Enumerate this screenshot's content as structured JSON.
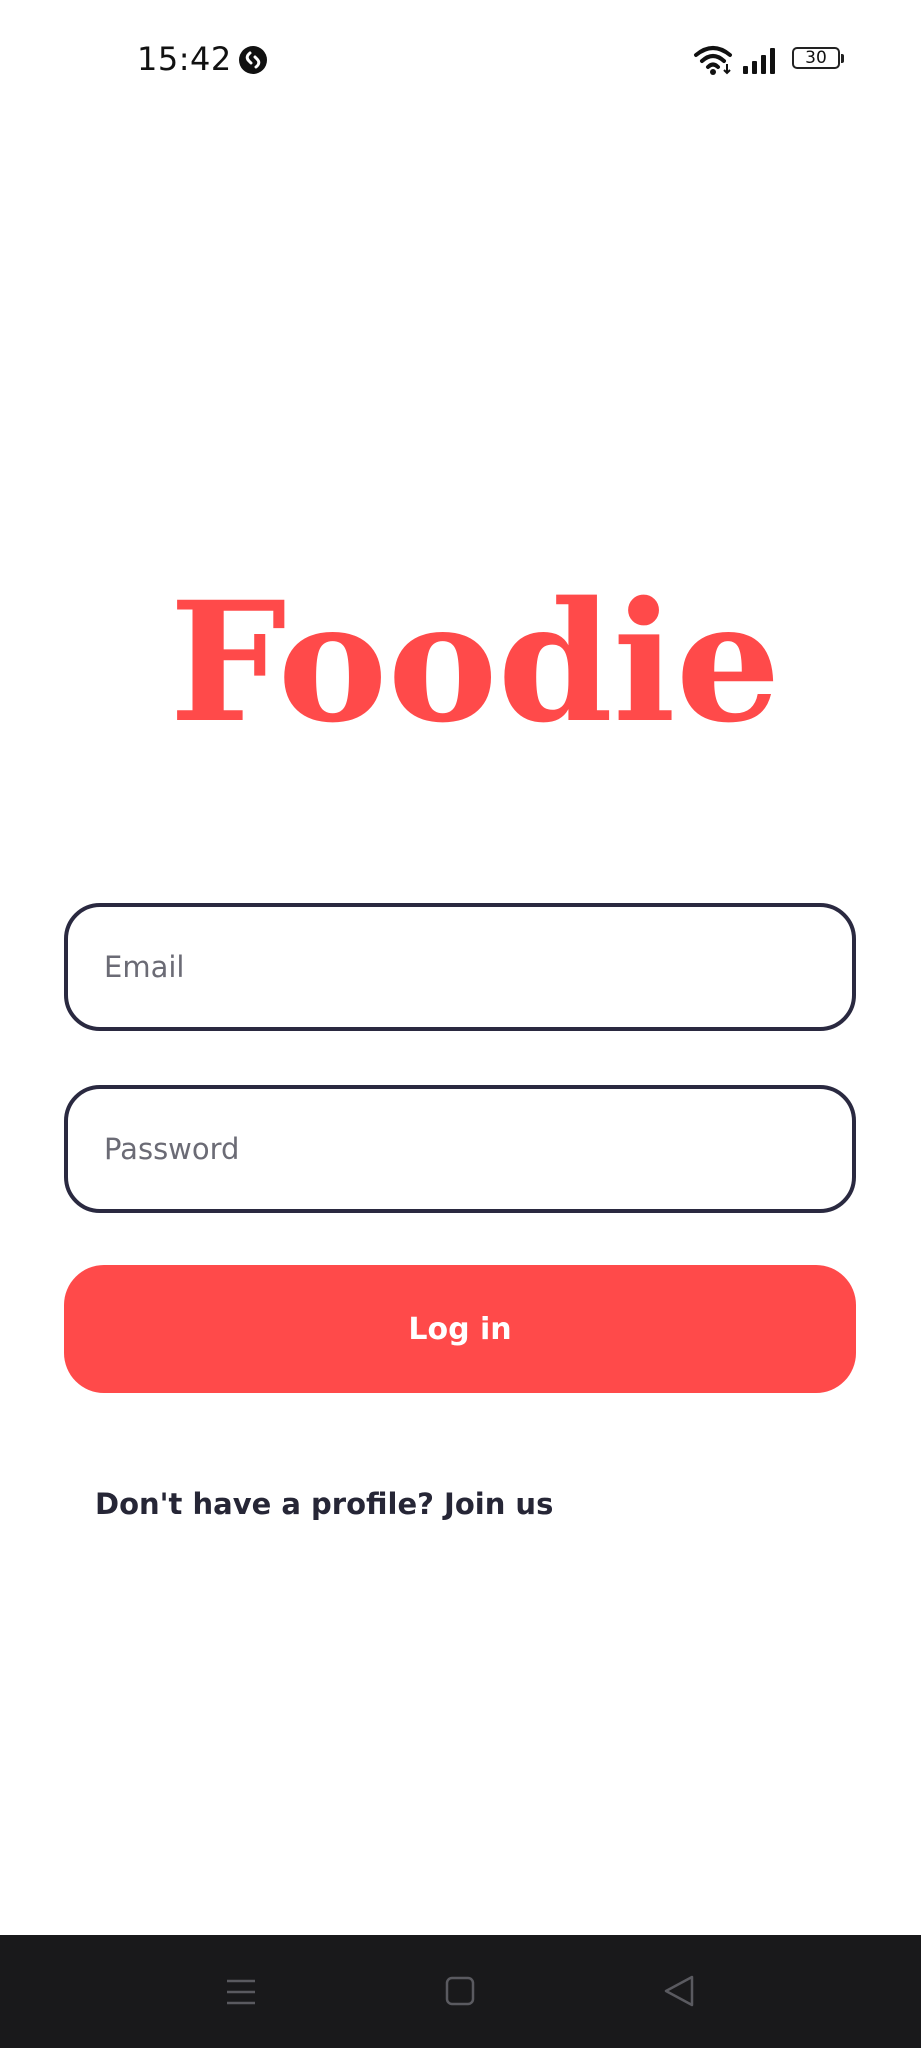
{
  "status_bar": {
    "time": "15:42",
    "battery_level": "30",
    "icons": [
      "shazam-icon",
      "wifi-icon",
      "signal-icon",
      "battery-icon"
    ]
  },
  "logo": {
    "text": "Foodie",
    "color": "#ff4a4a"
  },
  "login_form": {
    "email_placeholder": "Email",
    "password_placeholder": "Password",
    "login_label": "Log in",
    "join_text": "Don't have a profile? Join us"
  },
  "nav_bar": {
    "icons": [
      "menu-icon",
      "home-icon",
      "back-icon"
    ]
  },
  "colors": {
    "accent": "#ff4a4a",
    "field_border": "#2a2940",
    "nav_background": "#19191b"
  }
}
